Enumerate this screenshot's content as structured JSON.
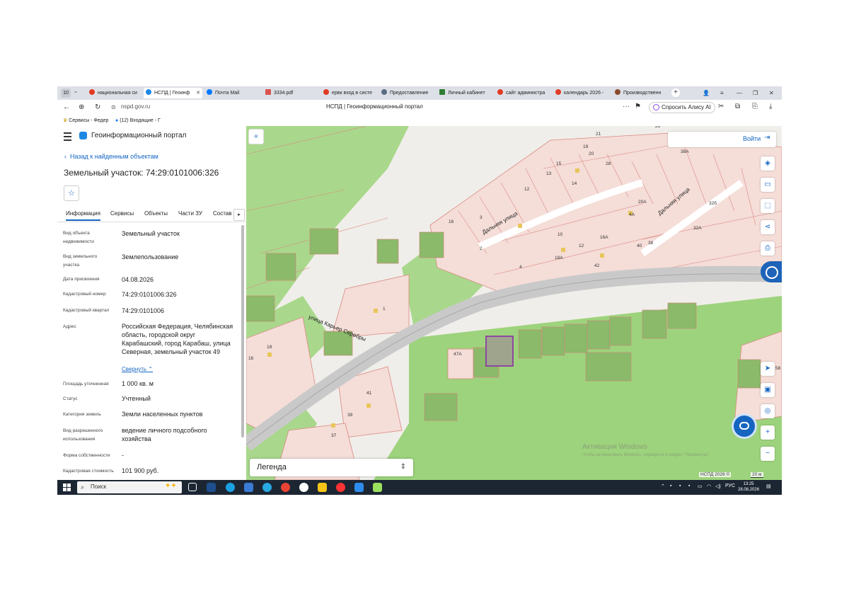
{
  "browser": {
    "tab_count": "10",
    "tabs": [
      {
        "label": "национальная си",
        "color": "#e03b24"
      },
      {
        "label": "НСПД | Геоинф",
        "color": "#1e88e5"
      },
      {
        "label": "Почта Mail",
        "color": "#0077ff"
      },
      {
        "label": "3334.pdf",
        "color": "#d9534f"
      },
      {
        "label": "ервк вход в систе",
        "color": "#e03b24"
      },
      {
        "label": "Предоставление",
        "color": "#5b6b82"
      },
      {
        "label": "Личный кабинет",
        "color": "#2e7d32"
      },
      {
        "label": "сайт администра",
        "color": "#e03b24"
      },
      {
        "label": "календарь 2026 -",
        "color": "#e03b24"
      },
      {
        "label": "Производственн",
        "color": "#8a4a2a"
      }
    ],
    "url": "nspd.gov.ru",
    "page_title": "НСПД | Геоинформационный портал",
    "alice_label": "Спросить Алису AI",
    "bookmarks": [
      "Сервисы - Федер",
      "(12) Входящие - Г"
    ]
  },
  "portal": {
    "app_title": "Геоинформационный портал",
    "back_link": "Назад к найденным объектам",
    "object_title": "Земельный участок: 74:29:0101006:326",
    "tabs": [
      "Информация",
      "Сервисы",
      "Объекты",
      "Части ЗУ",
      "Состав"
    ],
    "properties": [
      {
        "label": "Вид объекта недвижимости",
        "value": "Земельный участок"
      },
      {
        "label": "Вид земельного участка",
        "value": "Землепользование"
      },
      {
        "label": "Дата присвоения",
        "value": "04.08.2026"
      },
      {
        "label": "Кадастровый номер",
        "value": "74:29:0101006:326"
      },
      {
        "label": "Кадастровый квартал",
        "value": "74:29:0101006"
      },
      {
        "label": "Адрес",
        "value": "Российская Федерация, Челябинская область, городской округ Карабашский, город Карабаш, улица Северная, земельный участок 49"
      },
      {
        "label": "Площадь уточненная",
        "value": "1 000 кв. м"
      },
      {
        "label": "Статус",
        "value": "Учтенный"
      },
      {
        "label": "Категория земель",
        "value": "Земли населенных пунктов"
      },
      {
        "label": "Вид разрешенного использования",
        "value": "ведение личного подсобного хозяйства"
      },
      {
        "label": "Форма собственности",
        "value": "-"
      },
      {
        "label": "Кадастровая стоимость",
        "value": "101 900 руб."
      }
    ],
    "collapse_label": "Свернуть"
  },
  "map": {
    "login_label": "Войти",
    "legend_label": "Легенда",
    "activation_title": "Активация Windows",
    "activation_sub": "Чтобы активировать Windows, перейдите в раздел \"Параметры\".",
    "attribution": "НСПД 2026 ©",
    "scale_label": "20 м",
    "streets": [
      "Дальняя улица",
      "Дальняя улица",
      "улица Карьер Серебры"
    ],
    "house_numbers": [
      "21",
      "19",
      "15",
      "13",
      "12",
      "14",
      "20",
      "28",
      "38А",
      "16",
      "3",
      "2",
      "4",
      "10",
      "12",
      "16А",
      "18А",
      "20А",
      "32А",
      "4А",
      "40",
      "38",
      "42",
      "26",
      "32б",
      "1",
      "18",
      "16",
      "41",
      "39",
      "37",
      "47А",
      "58"
    ],
    "colors": {
      "parcel_fill": "#f5d9d4",
      "parcel_stroke": "#d98a7e",
      "green": "#9dd37c",
      "road": "#b8b8b8",
      "selected": "#8a2ea8"
    }
  },
  "taskbar": {
    "search_placeholder": "Поиск",
    "language": "РУС",
    "time": "13:25",
    "date": "28.08.2026"
  }
}
